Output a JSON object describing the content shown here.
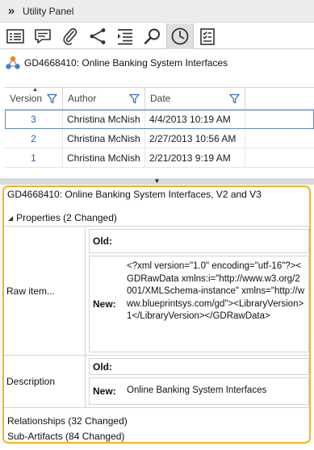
{
  "panel": {
    "title": "Utility Panel",
    "collapse_glyph": "»"
  },
  "toolbar": {
    "buttons": [
      {
        "icon": "properties-icon",
        "active": false
      },
      {
        "icon": "discussions-icon",
        "active": false
      },
      {
        "icon": "attachments-icon",
        "active": false
      },
      {
        "icon": "relationships-icon",
        "active": false
      },
      {
        "icon": "list-icon",
        "active": false
      },
      {
        "icon": "search-icon",
        "active": false
      },
      {
        "icon": "history-clock-icon",
        "active": true
      },
      {
        "icon": "review-checklist-icon",
        "active": false
      }
    ]
  },
  "artifact": {
    "title": "GD4668410: Online Banking System Interfaces"
  },
  "history_grid": {
    "columns": [
      "Version",
      "Author",
      "Date"
    ],
    "rows": [
      {
        "version": "3",
        "author": "Christina McNish",
        "date": "4/4/2013 10:19 AM"
      },
      {
        "version": "2",
        "author": "Christina McNish",
        "date": "2/27/2013 10:56 AM"
      },
      {
        "version": "1",
        "author": "Christina McNish",
        "date": "2/21/2013 9:19 AM"
      }
    ]
  },
  "compare": {
    "title": "GD4668410: Online Banking System Interfaces, V2 and V3",
    "properties_label": "Properties (2 Changed)",
    "raw_item": {
      "name": "Raw item...",
      "old_label": "Old:",
      "old_value": "",
      "new_label": "New:",
      "new_value": "<?xml version=\"1.0\" encoding=\"utf-16\"?><GDRawData xmlns:i=\"http://www.w3.org/2001/XMLSchema-instance\" xmlns=\"http://www.blueprintsys.com/gd\"><LibraryVersion>1</LibraryVersion></GDRawData>"
    },
    "description": {
      "name": "Description",
      "old_label": "Old:",
      "old_value": "",
      "new_label": "New:",
      "new_value": "Online Banking System Interfaces"
    },
    "relationships_label": "Relationships (32 Changed)",
    "subartifacts_label": "Sub-Artifacts (84 Changed)"
  },
  "colors": {
    "accent_border": "#f0b51f",
    "link_blue": "#2a5fb0",
    "selection_outline": "#5a88c6"
  }
}
